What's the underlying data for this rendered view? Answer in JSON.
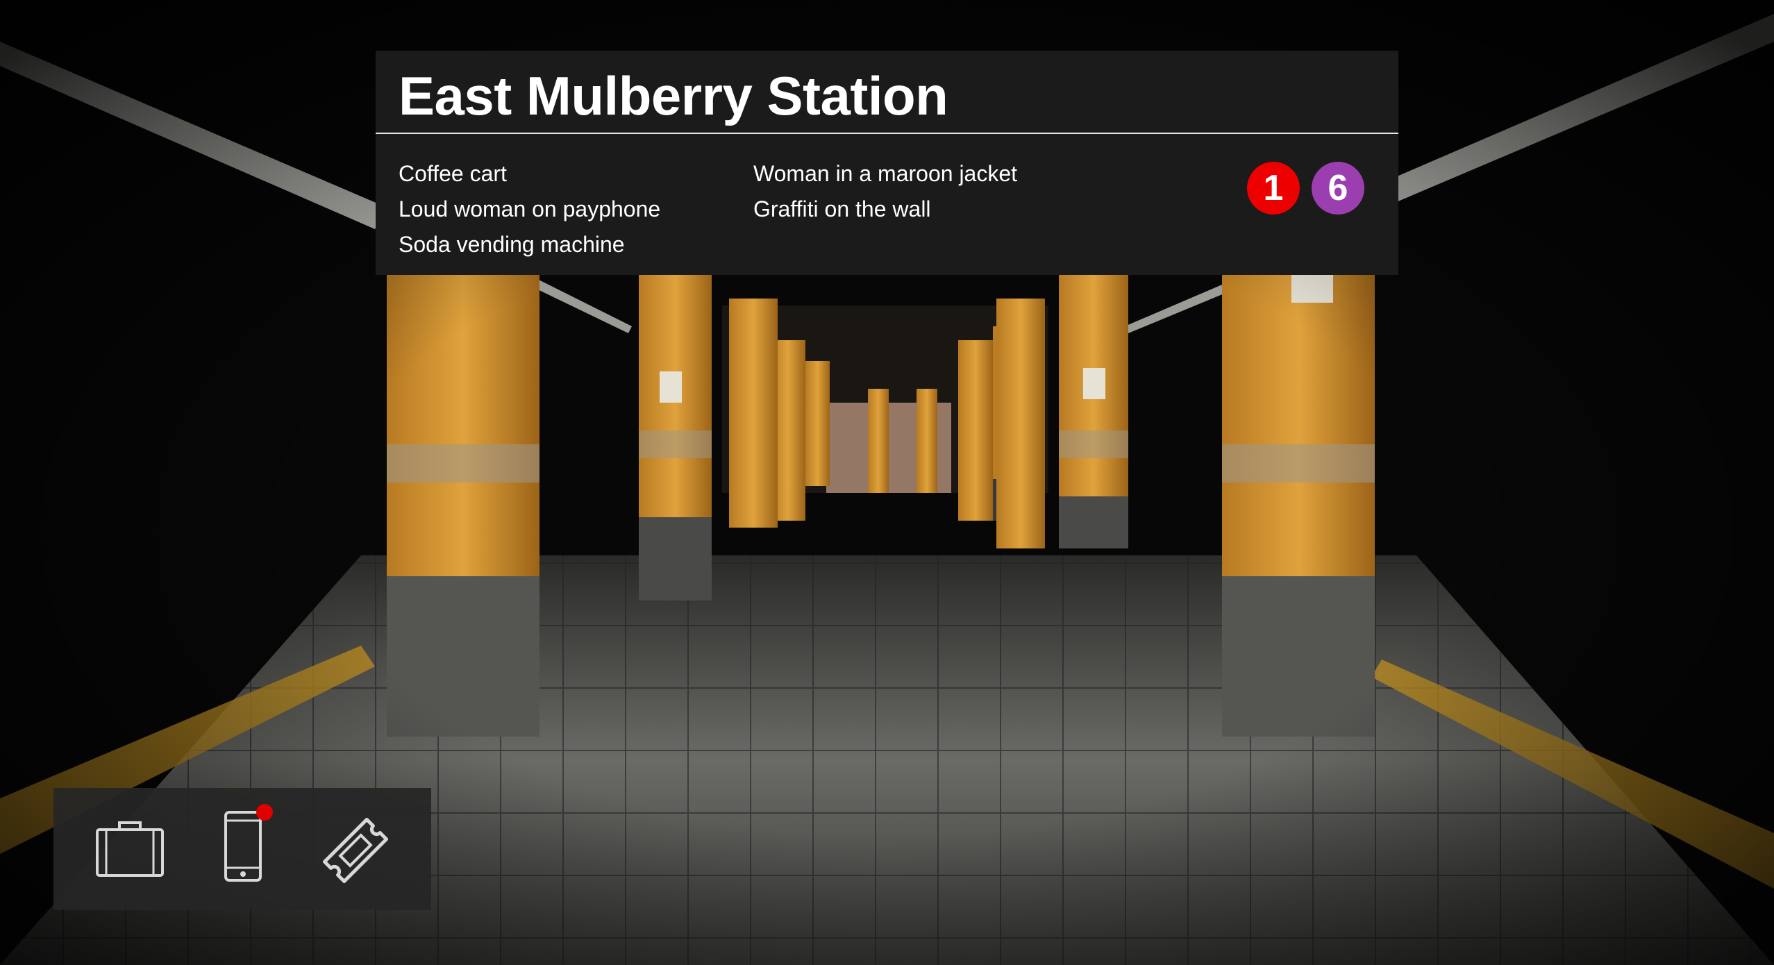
{
  "station": {
    "name": "East Mulberry Station",
    "objects_left": [
      "Coffee cart",
      "Loud woman on payphone",
      "Soda vending machine"
    ],
    "objects_right": [
      "Woman in a maroon jacket",
      "Graffiti on the wall"
    ],
    "lines": [
      {
        "label": "1",
        "color": "#ee0000"
      },
      {
        "label": "6",
        "color": "#9b3fb0"
      }
    ]
  },
  "inventory": {
    "items": [
      {
        "icon": "briefcase-icon"
      },
      {
        "icon": "phone-icon",
        "has_notification": true,
        "notification_color": "#e00000"
      },
      {
        "icon": "ticket-icon"
      }
    ]
  },
  "colors": {
    "panel_bg": "#1b1b1b",
    "pillar_orange": "#d99a33",
    "platform_edge": "#d7a52a"
  }
}
